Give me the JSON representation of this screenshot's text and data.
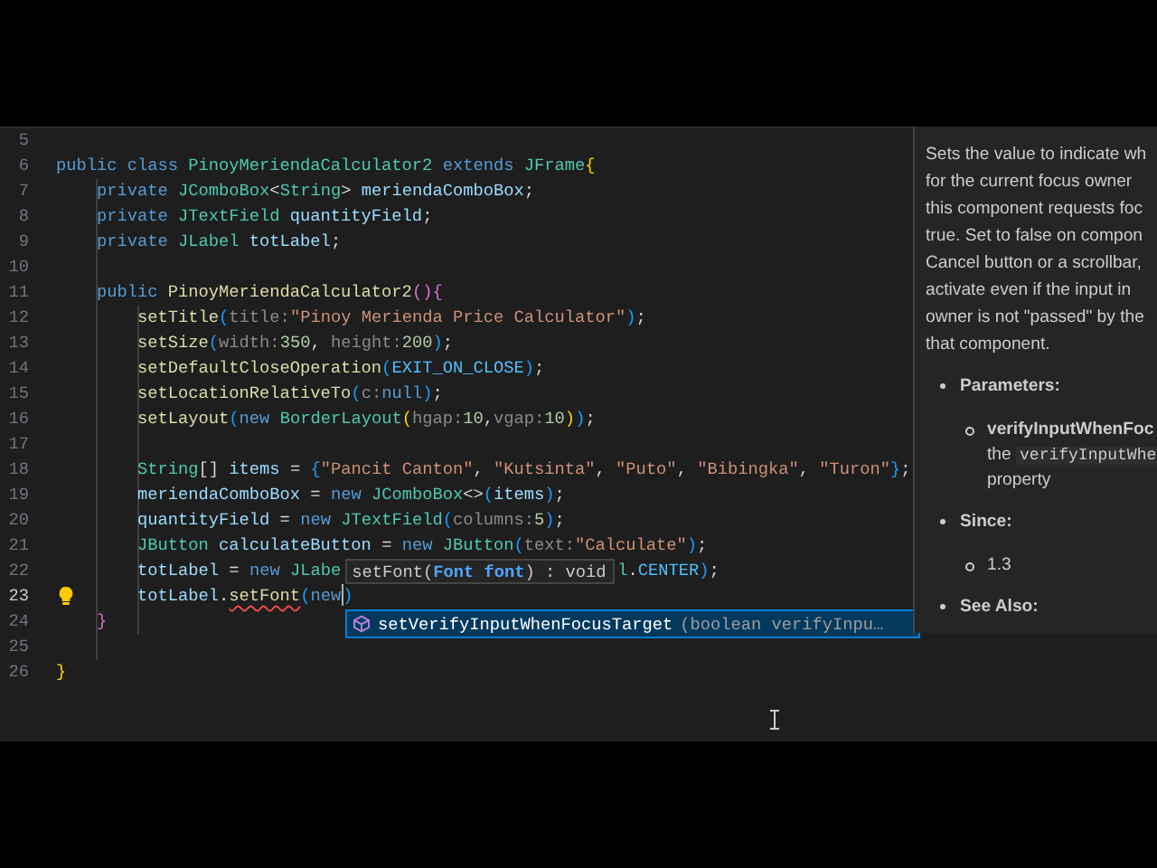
{
  "editor": {
    "lines": [
      {
        "number": "5",
        "current": false,
        "lightbulb": false
      },
      {
        "number": "6",
        "current": false,
        "lightbulb": false,
        "tokens": [
          {
            "t": "public ",
            "kind": "kw"
          },
          {
            "t": "class ",
            "kind": "kw"
          },
          {
            "t": "PinoyMeriendaCalculator2 ",
            "kind": "type"
          },
          {
            "t": "extends ",
            "kind": "kw"
          },
          {
            "t": "JFrame",
            "kind": "type"
          },
          {
            "t": "{",
            "kind": "b1"
          }
        ]
      },
      {
        "number": "7",
        "current": false,
        "lightbulb": false,
        "tokens": [
          {
            "t": "    private ",
            "kind": "kw"
          },
          {
            "t": "JComboBox",
            "kind": "type"
          },
          {
            "t": "<",
            "kind": "p"
          },
          {
            "t": "String",
            "kind": "type"
          },
          {
            "t": "> ",
            "kind": "p"
          },
          {
            "t": "meriendaComboBox",
            "kind": "var"
          },
          {
            "t": ";",
            "kind": "p"
          }
        ]
      },
      {
        "number": "8",
        "current": false,
        "lightbulb": false,
        "tokens": [
          {
            "t": "    private ",
            "kind": "kw"
          },
          {
            "t": "JTextField ",
            "kind": "type"
          },
          {
            "t": "quantityField",
            "kind": "var"
          },
          {
            "t": ";",
            "kind": "p"
          }
        ]
      },
      {
        "number": "9",
        "current": false,
        "lightbulb": false,
        "tokens": [
          {
            "t": "    private ",
            "kind": "kw"
          },
          {
            "t": "JLabel ",
            "kind": "type"
          },
          {
            "t": "totLabel",
            "kind": "var"
          },
          {
            "t": ";",
            "kind": "p"
          }
        ]
      },
      {
        "number": "10",
        "current": false,
        "lightbulb": false
      },
      {
        "number": "11",
        "current": false,
        "lightbulb": false,
        "tokens": [
          {
            "t": "    public ",
            "kind": "kw"
          },
          {
            "t": "PinoyMeriendaCalculator2",
            "kind": "fn"
          },
          {
            "t": "(){",
            "kind": "b2"
          }
        ]
      },
      {
        "number": "12",
        "current": false,
        "lightbulb": false,
        "tokens": [
          {
            "t": "        setTitle",
            "kind": "fn"
          },
          {
            "t": "(",
            "kind": "b3"
          },
          {
            "t": "title:",
            "kind": "hint"
          },
          {
            "t": "\"Pinoy Merienda Price Calculator\"",
            "kind": "str"
          },
          {
            "t": ")",
            "kind": "b3"
          },
          {
            "t": ";",
            "kind": "p"
          }
        ]
      },
      {
        "number": "13",
        "current": false,
        "lightbulb": false,
        "tokens": [
          {
            "t": "        setSize",
            "kind": "fn"
          },
          {
            "t": "(",
            "kind": "b3"
          },
          {
            "t": "width:",
            "kind": "hint"
          },
          {
            "t": "350",
            "kind": "num"
          },
          {
            "t": ", ",
            "kind": "p"
          },
          {
            "t": "height:",
            "kind": "hint"
          },
          {
            "t": "200",
            "kind": "num"
          },
          {
            "t": ")",
            "kind": "b3"
          },
          {
            "t": ";",
            "kind": "p"
          }
        ]
      },
      {
        "number": "14",
        "current": false,
        "lightbulb": false,
        "tokens": [
          {
            "t": "        setDefaultCloseOperation",
            "kind": "fn"
          },
          {
            "t": "(",
            "kind": "b3"
          },
          {
            "t": "EXIT_ON_CLOSE",
            "kind": "const"
          },
          {
            "t": ")",
            "kind": "b3"
          },
          {
            "t": ";",
            "kind": "p"
          }
        ]
      },
      {
        "number": "15",
        "current": false,
        "lightbulb": false,
        "tokens": [
          {
            "t": "        setLocationRelativeTo",
            "kind": "fn"
          },
          {
            "t": "(",
            "kind": "b3"
          },
          {
            "t": "c:",
            "kind": "hint"
          },
          {
            "t": "null",
            "kind": "kw"
          },
          {
            "t": ")",
            "kind": "b3"
          },
          {
            "t": ";",
            "kind": "p"
          }
        ]
      },
      {
        "number": "16",
        "current": false,
        "lightbulb": false,
        "tokens": [
          {
            "t": "        setLayout",
            "kind": "fn"
          },
          {
            "t": "(",
            "kind": "b3"
          },
          {
            "t": "new ",
            "kind": "kw"
          },
          {
            "t": "BorderLayout",
            "kind": "type"
          },
          {
            "t": "(",
            "kind": "b1"
          },
          {
            "t": "hgap:",
            "kind": "hint"
          },
          {
            "t": "10",
            "kind": "num"
          },
          {
            "t": ",",
            "kind": "p"
          },
          {
            "t": "vgap:",
            "kind": "hint"
          },
          {
            "t": "10",
            "kind": "num"
          },
          {
            "t": ")",
            "kind": "b1"
          },
          {
            "t": ")",
            "kind": "b3"
          },
          {
            "t": ";",
            "kind": "p"
          }
        ]
      },
      {
        "number": "17",
        "current": false,
        "lightbulb": false
      },
      {
        "number": "18",
        "current": false,
        "lightbulb": false,
        "tokens": [
          {
            "t": "        String",
            "kind": "type"
          },
          {
            "t": "[] ",
            "kind": "p"
          },
          {
            "t": "items",
            "kind": "var"
          },
          {
            "t": " = ",
            "kind": "p"
          },
          {
            "t": "{",
            "kind": "b3"
          },
          {
            "t": "\"Pancit Canton\"",
            "kind": "str"
          },
          {
            "t": ", ",
            "kind": "p"
          },
          {
            "t": "\"Kutsinta\"",
            "kind": "str"
          },
          {
            "t": ", ",
            "kind": "p"
          },
          {
            "t": "\"Puto\"",
            "kind": "str"
          },
          {
            "t": ", ",
            "kind": "p"
          },
          {
            "t": "\"Bibingka\"",
            "kind": "str"
          },
          {
            "t": ", ",
            "kind": "p"
          },
          {
            "t": "\"Turon\"",
            "kind": "str"
          },
          {
            "t": "}",
            "kind": "b3"
          },
          {
            "t": ";",
            "kind": "p"
          }
        ]
      },
      {
        "number": "19",
        "current": false,
        "lightbulb": false,
        "tokens": [
          {
            "t": "        meriendaComboBox",
            "kind": "var"
          },
          {
            "t": " = ",
            "kind": "p"
          },
          {
            "t": "new ",
            "kind": "kw"
          },
          {
            "t": "JComboBox",
            "kind": "type"
          },
          {
            "t": "<>",
            "kind": "p"
          },
          {
            "t": "(",
            "kind": "b3"
          },
          {
            "t": "items",
            "kind": "var"
          },
          {
            "t": ")",
            "kind": "b3"
          },
          {
            "t": ";",
            "kind": "p"
          }
        ]
      },
      {
        "number": "20",
        "current": false,
        "lightbulb": false,
        "tokens": [
          {
            "t": "        quantityField",
            "kind": "var"
          },
          {
            "t": " = ",
            "kind": "p"
          },
          {
            "t": "new ",
            "kind": "kw"
          },
          {
            "t": "JTextField",
            "kind": "type"
          },
          {
            "t": "(",
            "kind": "b3"
          },
          {
            "t": "columns:",
            "kind": "hint"
          },
          {
            "t": "5",
            "kind": "num"
          },
          {
            "t": ")",
            "kind": "b3"
          },
          {
            "t": ";",
            "kind": "p"
          }
        ]
      },
      {
        "number": "21",
        "current": false,
        "lightbulb": false,
        "tokens": [
          {
            "t": "        JButton ",
            "kind": "type"
          },
          {
            "t": "calculateButton",
            "kind": "var"
          },
          {
            "t": " = ",
            "kind": "p"
          },
          {
            "t": "new ",
            "kind": "kw"
          },
          {
            "t": "JButton",
            "kind": "type"
          },
          {
            "t": "(",
            "kind": "b3"
          },
          {
            "t": "text:",
            "kind": "hint"
          },
          {
            "t": "\"Calculate\"",
            "kind": "str"
          },
          {
            "t": ")",
            "kind": "b3"
          },
          {
            "t": ";",
            "kind": "p"
          }
        ]
      },
      {
        "number": "22",
        "current": false,
        "lightbulb": false,
        "tokens": [
          {
            "t": "        totLabel",
            "kind": "var"
          },
          {
            "t": " = ",
            "kind": "p"
          },
          {
            "t": "new ",
            "kind": "kw"
          },
          {
            "t": "JLabe",
            "kind": "type"
          }
        ],
        "tokens_after_hint": [
          {
            "t": "l",
            "kind": "type"
          },
          {
            "t": ".",
            "kind": "p"
          },
          {
            "t": "CENTER",
            "kind": "const"
          },
          {
            "t": ")",
            "kind": "b3"
          },
          {
            "t": ";",
            "kind": "p"
          }
        ]
      },
      {
        "number": "23",
        "current": true,
        "lightbulb": true,
        "tokens": [
          {
            "t": "        totLabel",
            "kind": "var"
          },
          {
            "t": ".",
            "kind": "p"
          },
          {
            "t": "setFont",
            "kind": "fn",
            "error": true
          },
          {
            "t": "(",
            "kind": "b3"
          },
          {
            "t": "new",
            "kind": "kw",
            "caret_after": true
          },
          {
            "t": ")",
            "kind": "b3"
          }
        ]
      },
      {
        "number": "24",
        "current": false,
        "lightbulb": false,
        "tokens": [
          {
            "t": "    }",
            "kind": "b2"
          }
        ]
      },
      {
        "number": "25",
        "current": false,
        "lightbulb": false
      },
      {
        "number": "26",
        "current": false,
        "lightbulb": false,
        "tokens": [
          {
            "t": "}",
            "kind": "b1"
          }
        ]
      }
    ]
  },
  "signature_help": {
    "name": "setFont(",
    "parameter": "Font font",
    "rest": ") : void"
  },
  "suggestion": {
    "label": "setVerifyInputWhenFocusTarget",
    "detail": "(boolean verifyInpu…",
    "selected": true
  },
  "documentation": {
    "paragraph": [
      "Sets the value to indicate wh",
      "for the current focus owner",
      "this component requests foc",
      "true. Set to false on compon",
      "Cancel button or a scrollbar,",
      "activate even if the input in",
      "owner is not \"passed\" by the",
      "that component."
    ],
    "parameters_heading": "Parameters:",
    "parameter_name": "verifyInputWhenFoc",
    "parameter_desc_prefix": "the",
    "parameter_desc_code": "verifyInputWhe",
    "parameter_desc_end": "property",
    "since_heading": "Since:",
    "since_value": "1.3",
    "see_also_heading": "See Also:"
  }
}
